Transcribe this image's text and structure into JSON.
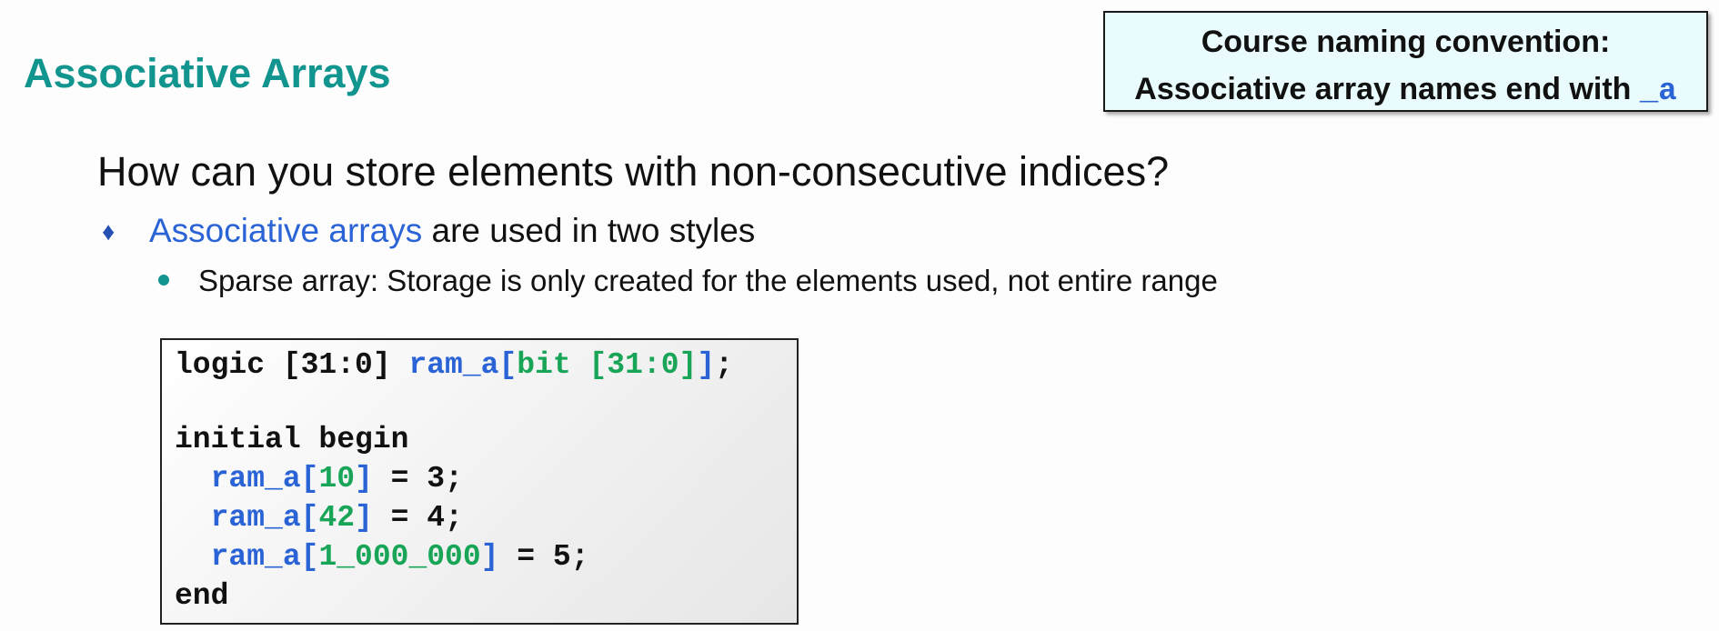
{
  "slide": {
    "title": "Associative Arrays"
  },
  "note": {
    "line1": "Course naming convention:",
    "line2_text": "Associative array names end with ",
    "line2_code": "_a"
  },
  "content": {
    "question": "How can you store elements with non-consecutive indices?",
    "bullet1": {
      "marker": "♦",
      "term": "Associative arrays",
      "rest": " are used in two styles"
    },
    "bullet2": {
      "text": "Sparse array: Storage is only created for the elements used, not entire range"
    }
  },
  "code": {
    "line1": {
      "a": "logic [31:0] ",
      "b": "ram_a[",
      "c": "bit [31:0]",
      "d": "]",
      "e": ";"
    },
    "line2": "initial begin",
    "line3": {
      "indent": "  ",
      "a": "ram_a[",
      "b": "10",
      "c": "]",
      "d": " = 3;"
    },
    "line4": {
      "indent": "  ",
      "a": "ram_a[",
      "b": "42",
      "c": "]",
      "d": " = 4;"
    },
    "line5": {
      "indent": "  ",
      "a": "ram_a[",
      "b": "1_000_000",
      "c": "]",
      "d": " = 5;"
    },
    "line6": "end"
  },
  "colors": {
    "title": "#12958f",
    "keyword_blue": "#2a63d6",
    "keyword_green": "#18a558",
    "note_background": "#e9fbfc"
  }
}
